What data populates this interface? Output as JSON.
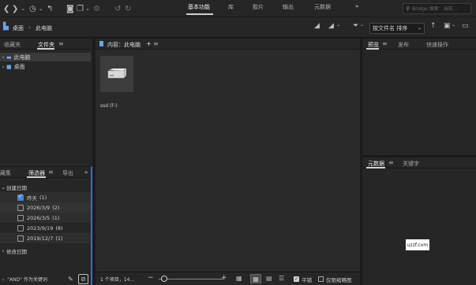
{
  "toolbar": {
    "workspaces": [
      "基本功能",
      "库",
      "胶片",
      "输出",
      "元数据"
    ],
    "active_workspace": "基本功能",
    "more": "»",
    "search_placeholder": "Bridge 搜索：当前..."
  },
  "pathbar": {
    "crumb_desktop": "桌面",
    "sep": "›",
    "crumb_pc": "此电脑",
    "sort_label": "按文件名 排序"
  },
  "left_panel": {
    "tabs": [
      "收藏夹",
      "文件夹"
    ],
    "active_tab": "文件夹",
    "tree": [
      {
        "label": "此电脑",
        "selected": true
      },
      {
        "label": "桌面",
        "selected": false
      }
    ]
  },
  "filter_panel": {
    "tabs": [
      "藏集",
      "筛选器",
      "导出"
    ],
    "active_tab": "筛选器",
    "more": "»",
    "group_created": "创建日期",
    "items": [
      {
        "label": "昨天",
        "count": "(1)",
        "checked": true
      },
      {
        "label": "2026/3/9",
        "count": "(2)",
        "checked": false
      },
      {
        "label": "2026/3/5",
        "count": "(1)",
        "checked": false
      },
      {
        "label": "2023/9/19",
        "count": "(8)",
        "checked": false
      },
      {
        "label": "2019/12/7",
        "count": "(1)",
        "checked": false
      }
    ],
    "group_modified": "修改日期",
    "footer_text": "\"AND\" 作为关键词"
  },
  "content": {
    "header": "内容：此电脑",
    "add": "+",
    "item_label": "ssd (F:)"
  },
  "status": {
    "count_text": "1 个项目，14...",
    "minus": "−",
    "plus": "+",
    "tile_label": "平铺",
    "thumb_only_label": "仅限缩略图"
  },
  "right_panel": {
    "top_tabs": [
      "预览",
      "发布",
      "快速操作"
    ],
    "active_top": "预览",
    "bottom_tabs": [
      "元数据",
      "关键字"
    ],
    "active_bottom": "元数据",
    "watermark": "uzzf.com"
  },
  "colors": {
    "accent": "#4a84d3",
    "panel_bg": "#262626",
    "content_bg": "#2a2a2a"
  }
}
